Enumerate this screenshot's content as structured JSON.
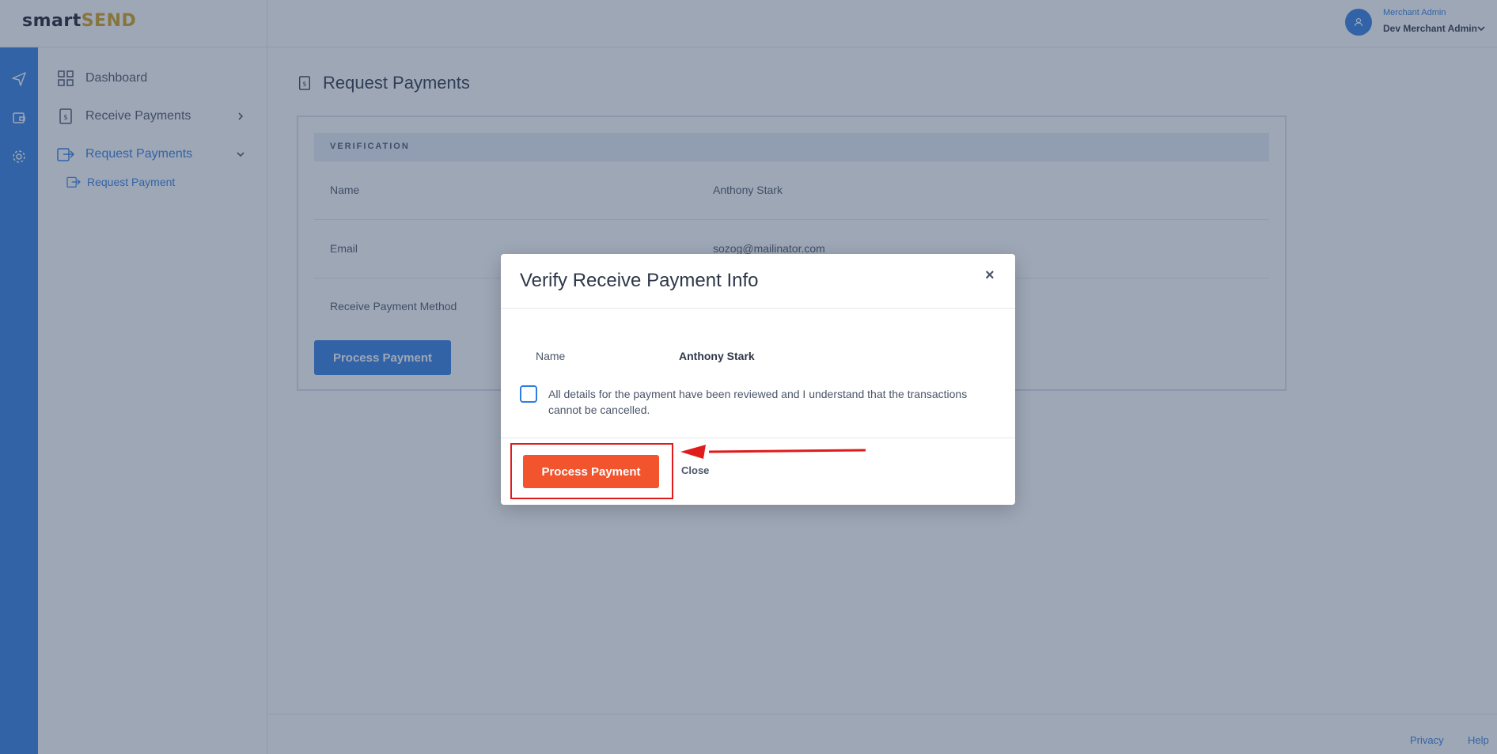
{
  "app": {
    "logo_part1": "smart",
    "logo_part2": "SEND",
    "brand_color": "#2f7de1",
    "accent_color": "#f2542d"
  },
  "user": {
    "role": "Merchant Admin",
    "name": "Dev Merchant Admin"
  },
  "sidebar": {
    "items": [
      {
        "label": "Dashboard",
        "icon": "grid-icon"
      },
      {
        "label": "Receive Payments",
        "icon": "receipt-icon"
      },
      {
        "label": "Request Payments",
        "icon": "request-icon"
      }
    ],
    "sub_item": "Request Payment"
  },
  "page": {
    "title": "Request Payments",
    "card_header": "VERIFICATION",
    "rows": [
      {
        "label": "Name",
        "value": "Anthony Stark"
      },
      {
        "label": "Email",
        "value": "sozog@mailinator.com"
      },
      {
        "label": "Receive Payment Method",
        "value": ""
      }
    ],
    "process_button": "Process Payment"
  },
  "footer": {
    "privacy": "Privacy",
    "help": "Help"
  },
  "modal": {
    "title": "Verify Receive Payment Info",
    "close_glyph": "×",
    "name_label": "Name",
    "name_value": "Anthony Stark",
    "consent_text": "All details for the payment have been reviewed and I understand that the transactions cannot be cancelled.",
    "process_button": "Process Payment",
    "close_button": "Close"
  },
  "annotation": {
    "color": "#e01b1b"
  }
}
